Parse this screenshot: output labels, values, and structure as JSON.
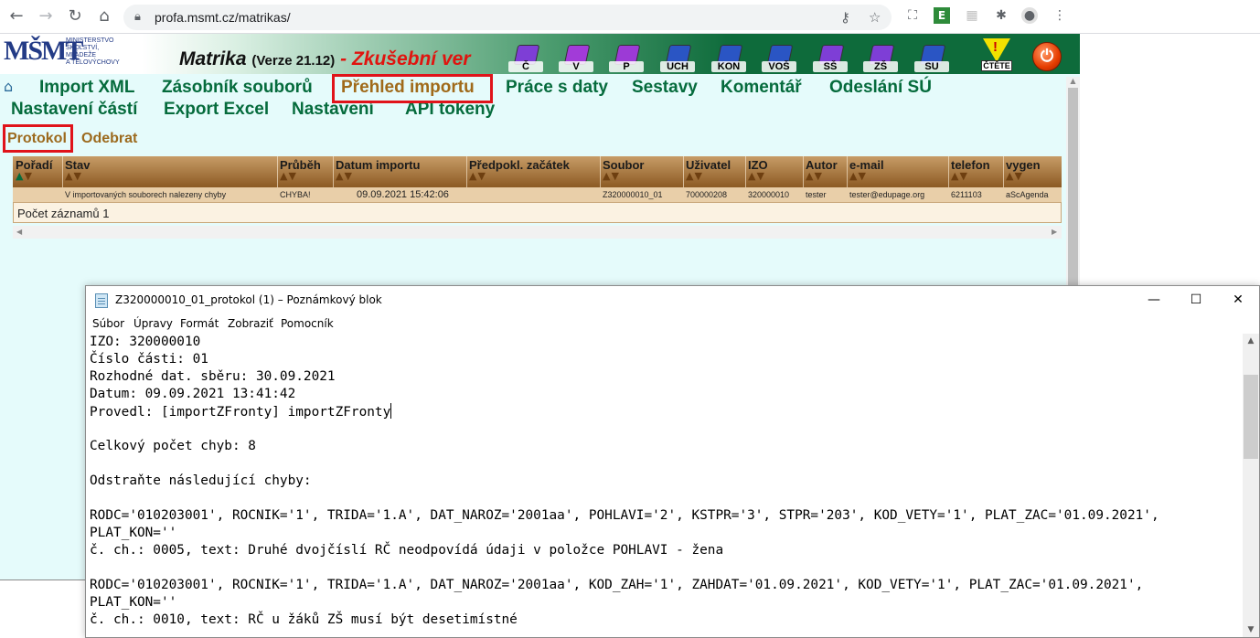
{
  "browser": {
    "url": "profa.msmt.cz/matrikas/"
  },
  "header": {
    "logo_text": "MŠMT",
    "ministry_lines": [
      "MINISTERSTVO",
      "ŠKOLSTVÍ,",
      "MLÁDEŽE",
      "A TĚLOVÝCHOVY"
    ],
    "app_name": "Matrika",
    "app_version": "(Verze 21.12)",
    "app_env": "- Zkušební ver",
    "icons": [
      {
        "label": "Č",
        "color": "#7e3ed6"
      },
      {
        "label": "V",
        "color": "#a23bd8"
      },
      {
        "label": "P",
        "color": "#9c3ad6"
      },
      {
        "label": "UCH",
        "color": "#2a55c4"
      },
      {
        "label": "KON",
        "color": "#2a55c4"
      },
      {
        "label": "VOŠ",
        "color": "#2a55c4"
      },
      {
        "label": "SŠ",
        "color": "#7e3ed6"
      },
      {
        "label": "ZŠ",
        "color": "#7e3ed6"
      },
      {
        "label": "SU",
        "color": "#2a55c4"
      }
    ],
    "warning_label": "ČTĚTE",
    "power_icon": "power-icon"
  },
  "menu": {
    "row1": [
      "Import XML",
      "Zásobník souborů",
      "Přehled importu",
      "Práce s daty",
      "Sestavy",
      "Komentář",
      "Odeslání SÚ"
    ],
    "row2": [
      "Nastavení částí",
      "Export Excel",
      "Nastavení",
      "API tokeny"
    ],
    "active": "Přehled importu"
  },
  "submenu": {
    "items": [
      "Protokol",
      "Odebrat"
    ],
    "active": "Protokol"
  },
  "grid": {
    "columns": [
      "Pořadí",
      "Stav",
      "Průběh",
      "Datum importu",
      "Předpokl. začátek",
      "Soubor",
      "Uživatel",
      "IZO",
      "Autor",
      "e-mail",
      "telefon",
      "vygen"
    ],
    "rows": [
      {
        "poradi": "",
        "stav": "V importovaných souborech nalezeny chyby",
        "prubeh": "CHYBA!",
        "datum": "09.09.2021 15:42:06",
        "zacatek": "",
        "soubor": "Z320000010_01",
        "uzivatel": "700000208",
        "izo": "320000010",
        "autor": "tester",
        "email": "tester@edupage.org",
        "telefon": "6211103",
        "vygen": "aScAgenda"
      }
    ],
    "footer": "Počet záznamů 1"
  },
  "notepad": {
    "title": "Z320000010_01_protokol (1) – Poznámkový blok",
    "menu": [
      "Súbor",
      "Úpravy",
      "Formát",
      "Zobraziť",
      "Pomocník"
    ],
    "lines": [
      "IZO: 320000010",
      "Číslo části: 01",
      "Rozhodné dat. sběru: 30.09.2021",
      "Datum: 09.09.2021 13:41:42",
      "Provedl: [importZFronty] importZFronty",
      "",
      "Celkový počet chyb: 8",
      "",
      "Odstraňte následující chyby:",
      "",
      "RODC='010203001', ROCNIK='1', TRIDA='1.A', DAT_NAROZ='2001aa', POHLAVI='2', KSTPR='3', STPR='203', KOD_VETY='1', PLAT_ZAC='01.09.2021',",
      "PLAT_KON=''",
      "č. ch.: 0005, text: Druhé dvojčíslí RČ neodpovídá údaji v položce POHLAVI - žena",
      "",
      "RODC='010203001', ROCNIK='1', TRIDA='1.A', DAT_NAROZ='2001aa', KOD_ZAH='1', ZAHDAT='01.09.2021', KOD_VETY='1', PLAT_ZAC='01.09.2021',",
      "PLAT_KON=''",
      "č. ch.: 0010, text: RČ u žáků ZŠ musí být desetimístné"
    ]
  }
}
